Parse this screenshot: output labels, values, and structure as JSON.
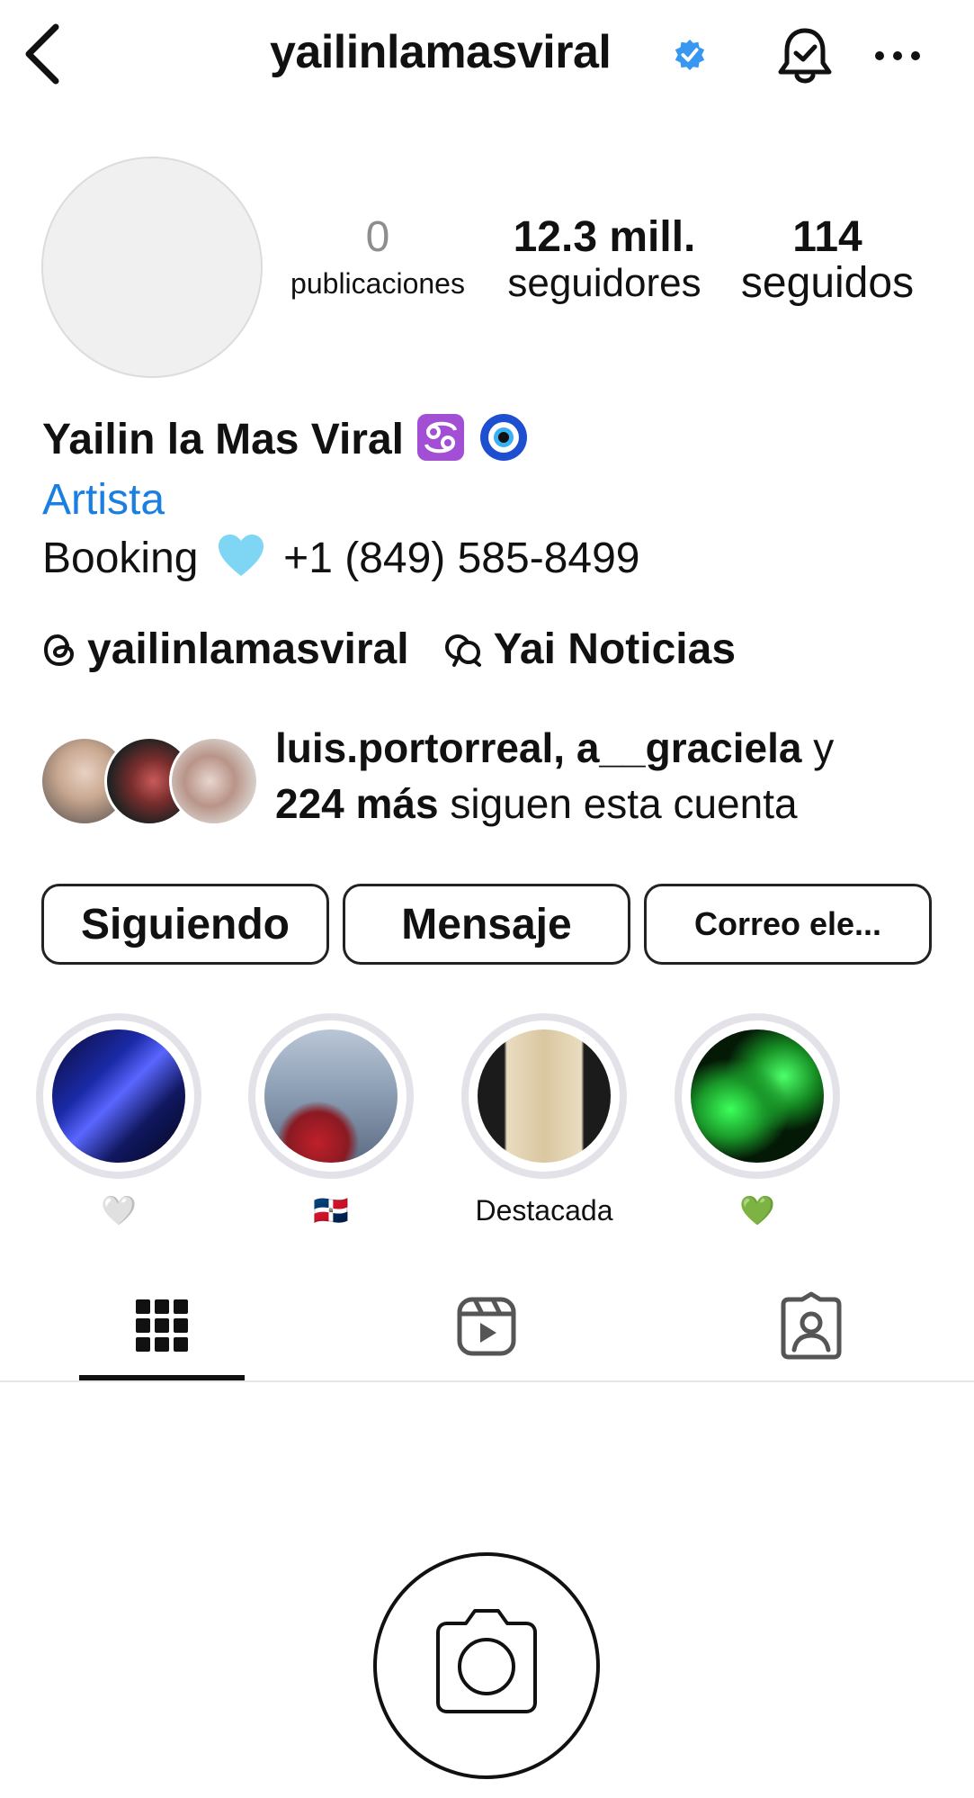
{
  "header": {
    "username": "yailinlamasviral"
  },
  "profile": {
    "stats": [
      {
        "value": "0",
        "label": "publicaciones"
      },
      {
        "value": "12.3 mill.",
        "label": "seguidores"
      },
      {
        "value": "114",
        "label": "seguidos"
      }
    ],
    "display_name": "Yailin la Mas Viral",
    "category": "Artista",
    "bio_prefix": "Booking",
    "bio_phone": "+1 (849) 585-8499",
    "threads_handle": "yailinlamasviral",
    "channel_name": "Yai Noticias",
    "followed_by": {
      "names": "luis.portorreal, a__graciela",
      "joiner": " y",
      "count": "224 más",
      "suffix": " siguen esta cuenta"
    }
  },
  "actions": {
    "following_label": "Siguiendo",
    "message_label": "Mensaje",
    "email_label": "Correo ele..."
  },
  "highlights": [
    {
      "caption": "🤍"
    },
    {
      "caption": "🇩🇴"
    },
    {
      "caption": "Destacada"
    },
    {
      "caption": "💚"
    }
  ],
  "colors": {
    "accent_blue": "#1a7fe0",
    "verified_blue": "#3897f0",
    "border": "#222222",
    "highlight_ring": "#e2e2e8"
  },
  "icons": [
    "back-icon",
    "verified-badge-icon",
    "bell-icon",
    "more-icon",
    "threads-icon",
    "channel-icon",
    "grid-icon",
    "reels-icon",
    "tagged-icon",
    "camera-icon"
  ]
}
